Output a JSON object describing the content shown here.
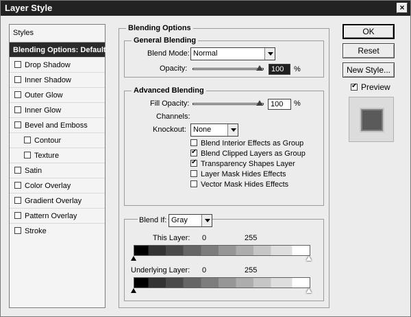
{
  "window": {
    "title": "Layer Style",
    "close_glyph": "×"
  },
  "styles_panel": {
    "header": "Styles",
    "selected": "Blending Options: Default",
    "items": [
      {
        "label": "Drop Shadow",
        "checked": false
      },
      {
        "label": "Inner Shadow",
        "checked": false
      },
      {
        "label": "Outer Glow",
        "checked": false
      },
      {
        "label": "Inner Glow",
        "checked": false
      },
      {
        "label": "Bevel and Emboss",
        "checked": false
      },
      {
        "label": "Contour",
        "checked": false
      },
      {
        "label": "Texture",
        "checked": false
      },
      {
        "label": "Satin",
        "checked": false
      },
      {
        "label": "Color Overlay",
        "checked": false
      },
      {
        "label": "Gradient Overlay",
        "checked": false
      },
      {
        "label": "Pattern Overlay",
        "checked": false
      },
      {
        "label": "Stroke",
        "checked": false
      }
    ]
  },
  "blending_options": {
    "title": "Blending Options",
    "general": {
      "title": "General Blending",
      "blend_mode_label": "Blend Mode:",
      "blend_mode_value": "Normal",
      "opacity_label": "Opacity:",
      "opacity_value": "100",
      "opacity_unit": "%"
    },
    "advanced": {
      "title": "Advanced Blending",
      "fill_opacity_label": "Fill Opacity:",
      "fill_opacity_value": "100",
      "fill_opacity_unit": "%",
      "channels_label": "Channels:",
      "knockout_label": "Knockout:",
      "knockout_value": "None",
      "options": [
        {
          "label": "Blend Interior Effects as Group",
          "checked": false
        },
        {
          "label": "Blend Clipped Layers as Group",
          "checked": true
        },
        {
          "label": "Transparency Shapes Layer",
          "checked": true
        },
        {
          "label": "Layer Mask Hides Effects",
          "checked": false
        },
        {
          "label": "Vector Mask Hides Effects",
          "checked": false
        }
      ]
    },
    "blend_if": {
      "label": "Blend If:",
      "value": "Gray",
      "this_layer_label": "This Layer:",
      "this_layer_min": "0",
      "this_layer_max": "255",
      "underlying_label": "Underlying Layer:",
      "underlying_min": "0",
      "underlying_max": "255"
    }
  },
  "buttons": {
    "ok": "OK",
    "reset": "Reset",
    "new_style": "New Style...",
    "preview": "Preview"
  },
  "preview_checked": true
}
